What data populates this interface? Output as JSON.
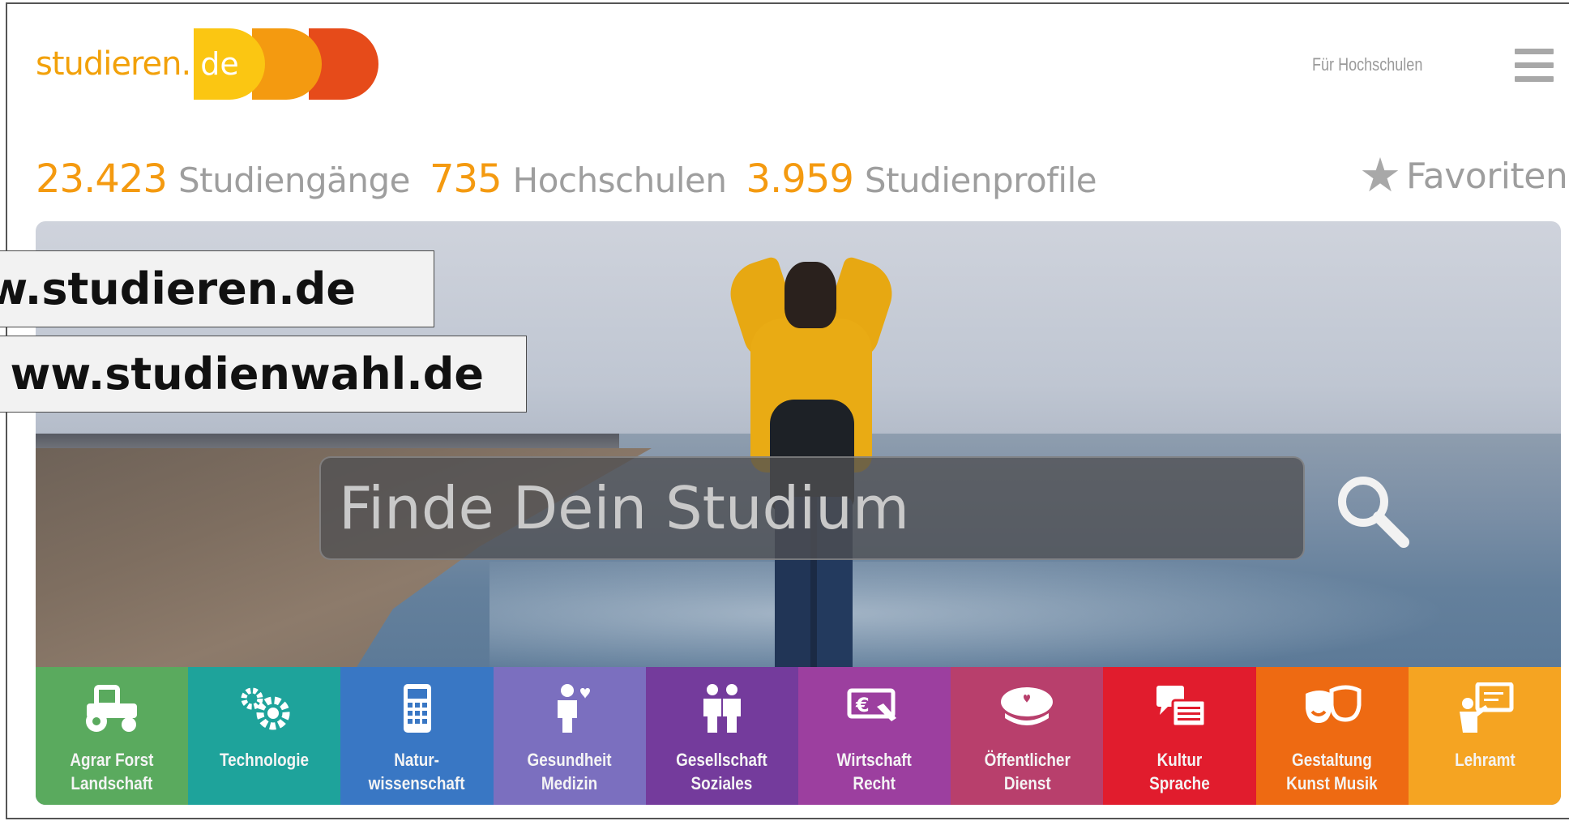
{
  "header": {
    "logo_text": "studieren.",
    "logo_tld": "de",
    "for_universities": "Für Hochschulen",
    "menu_icon": "hamburger-menu-icon"
  },
  "stats": [
    {
      "number": "23.423",
      "label": "Studiengänge"
    },
    {
      "number": "735",
      "label": "Hochschulen"
    },
    {
      "number": "3.959",
      "label": "Studienprofile"
    }
  ],
  "favorites": {
    "icon": "star-icon",
    "label": "Favoriten"
  },
  "search": {
    "placeholder": "Finde Dein Studium",
    "icon": "search-icon"
  },
  "categories": [
    {
      "label": "Agrar Forst\nLandschaft",
      "icon": "tractor-icon",
      "color": "#5aaa5e"
    },
    {
      "label": "Technologie",
      "icon": "gears-icon",
      "color": "#1ea39b"
    },
    {
      "label": "Natur-\nwissenschaft",
      "icon": "calculator-icon",
      "color": "#3977c4"
    },
    {
      "label": "Gesundheit\nMedizin",
      "icon": "person-heart-icon",
      "color": "#7b6fbf"
    },
    {
      "label": "Gesellschaft\nSoziales",
      "icon": "people-icon",
      "color": "#743b9c"
    },
    {
      "label": "Wirtschaft\nRecht",
      "icon": "euro-hand-icon",
      "color": "#9c3f9f"
    },
    {
      "label": "Öffentlicher\nDienst",
      "icon": "police-cap-icon",
      "color": "#b83f6c"
    },
    {
      "label": "Kultur\nSprache",
      "icon": "speech-bubbles-icon",
      "color": "#e11c2d"
    },
    {
      "label": "Gestaltung\nKunst Musik",
      "icon": "theater-masks-icon",
      "color": "#ee6a12"
    },
    {
      "label": "Lehramt",
      "icon": "teacher-board-icon",
      "color": "#f5a422"
    }
  ],
  "overlays": {
    "url1": "w.studieren.de",
    "url2": "ww.studienwahl.de"
  },
  "colors": {
    "accent": "#f49a10",
    "logo_yellow": "#fbc612",
    "logo_red": "#e64b1a",
    "muted_text": "#9e9e9e"
  }
}
